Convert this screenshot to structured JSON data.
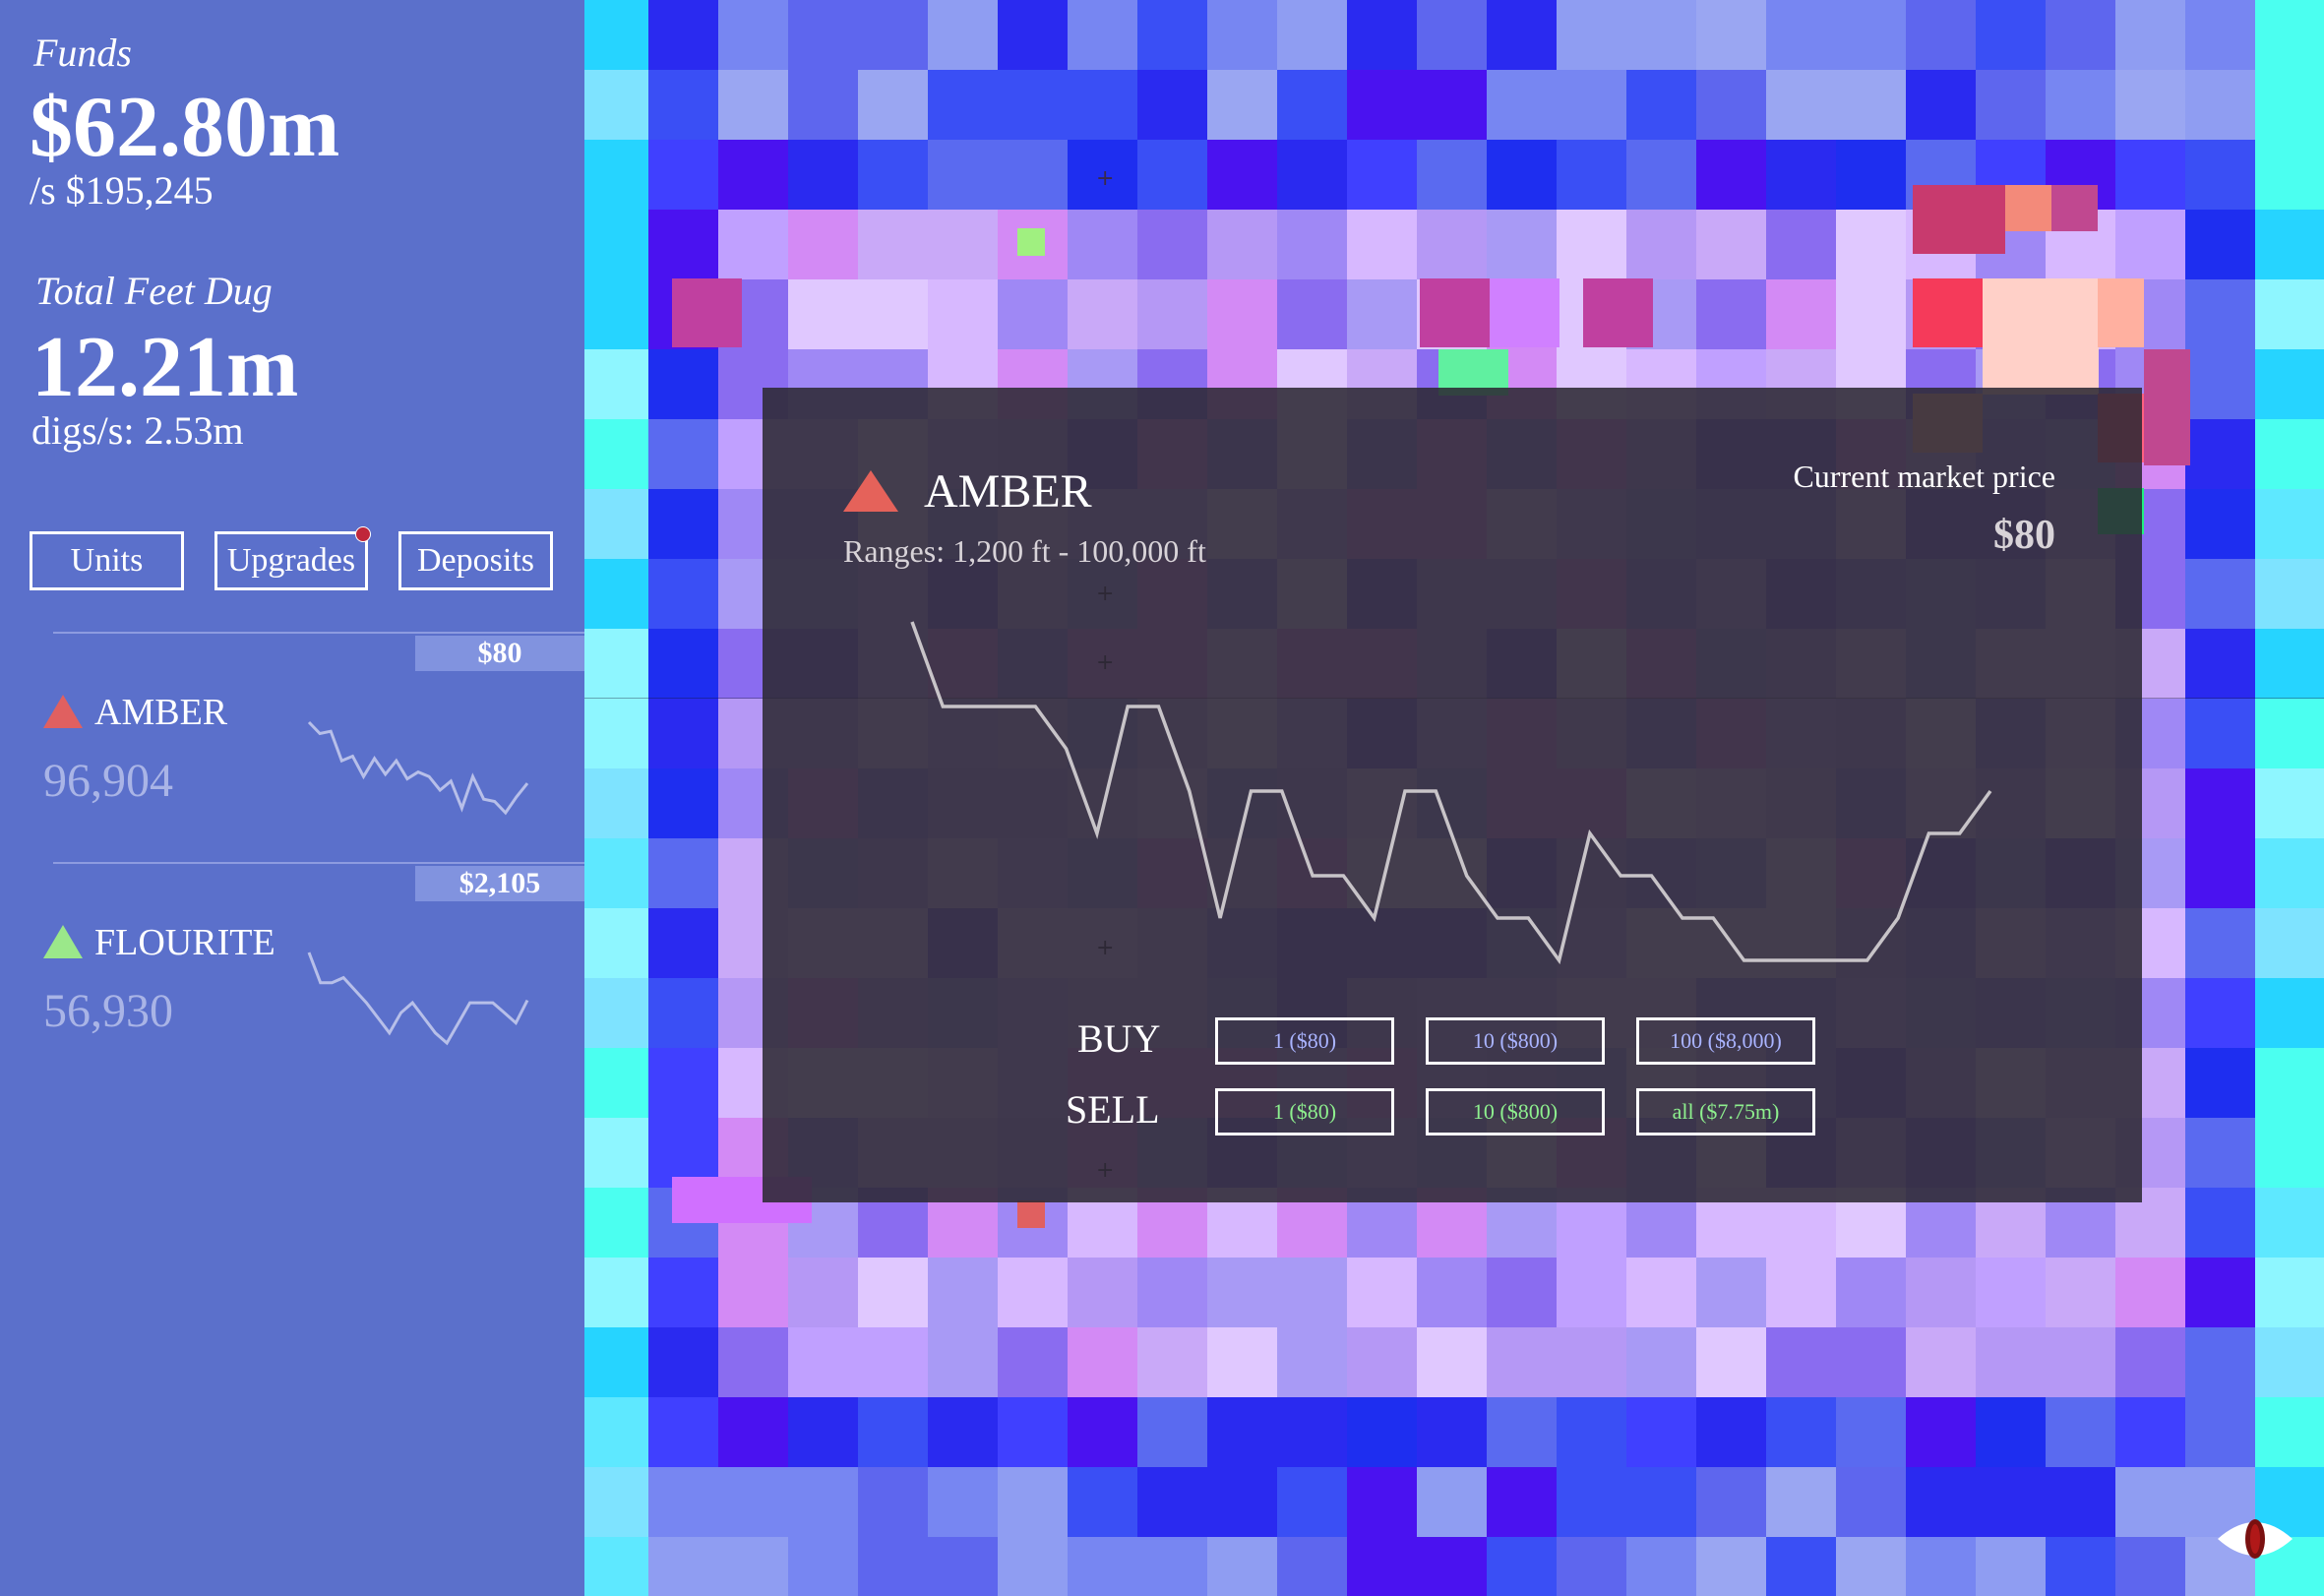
{
  "stats": {
    "funds_label": "Funds",
    "funds_value": "$62.80m",
    "funds_rate": "/s $195,245",
    "feet_label": "Total Feet Dug",
    "feet_value": "12.21m",
    "feet_rate": "digs/s: 2.53m"
  },
  "tabs": [
    {
      "label": "Units",
      "notification": false
    },
    {
      "label": "Upgrades",
      "notification": true
    },
    {
      "label": "Deposits",
      "notification": false
    }
  ],
  "minerals": [
    {
      "name": "AMBER",
      "count": "96,904",
      "price": "$80",
      "trend": "down",
      "color": "#e06060",
      "sparkline": [
        4,
        3.5,
        3.6,
        2.3,
        2.5,
        1.6,
        2.4,
        1.7,
        2.3,
        1.5,
        1.8,
        1.6,
        1.0,
        1.4,
        0.2,
        1.6,
        0.6,
        0.5,
        0.0,
        0.7,
        1.3
      ]
    },
    {
      "name": "FLOURITE",
      "count": "56,930",
      "price": "$2,105",
      "trend": "up",
      "color": "#9be88a",
      "sparkline": [
        3.6,
        2.4,
        2.4,
        2.6,
        2.1,
        1.6,
        1.0,
        0.4,
        1.2,
        1.6,
        1.0,
        0.4,
        0.0,
        0.8,
        1.6,
        1.6,
        1.6,
        1.2,
        0.8,
        1.7
      ]
    }
  ],
  "modal": {
    "name": "AMBER",
    "ranges": "Ranges: 1,200 ft - 100,000 ft",
    "market_label": "Current market price",
    "market_price": "$80",
    "price_history": [
      9,
      7,
      7,
      7,
      7,
      6,
      4,
      7,
      7,
      5,
      2,
      5,
      5,
      3,
      3,
      2,
      5,
      5,
      3,
      2,
      2,
      1,
      4,
      3,
      3,
      2,
      2,
      1,
      1,
      1,
      1,
      1,
      2,
      4,
      4,
      5
    ],
    "buy_label": "BUY",
    "sell_label": "SELL",
    "buy_options": [
      "1 ($80)",
      "10 ($800)",
      "100 ($8,000)"
    ],
    "sell_options": [
      "1 ($80)",
      "10 ($800)",
      "all ($7.75m)"
    ]
  },
  "icons": {
    "visibility_toggle": "eye-icon"
  }
}
